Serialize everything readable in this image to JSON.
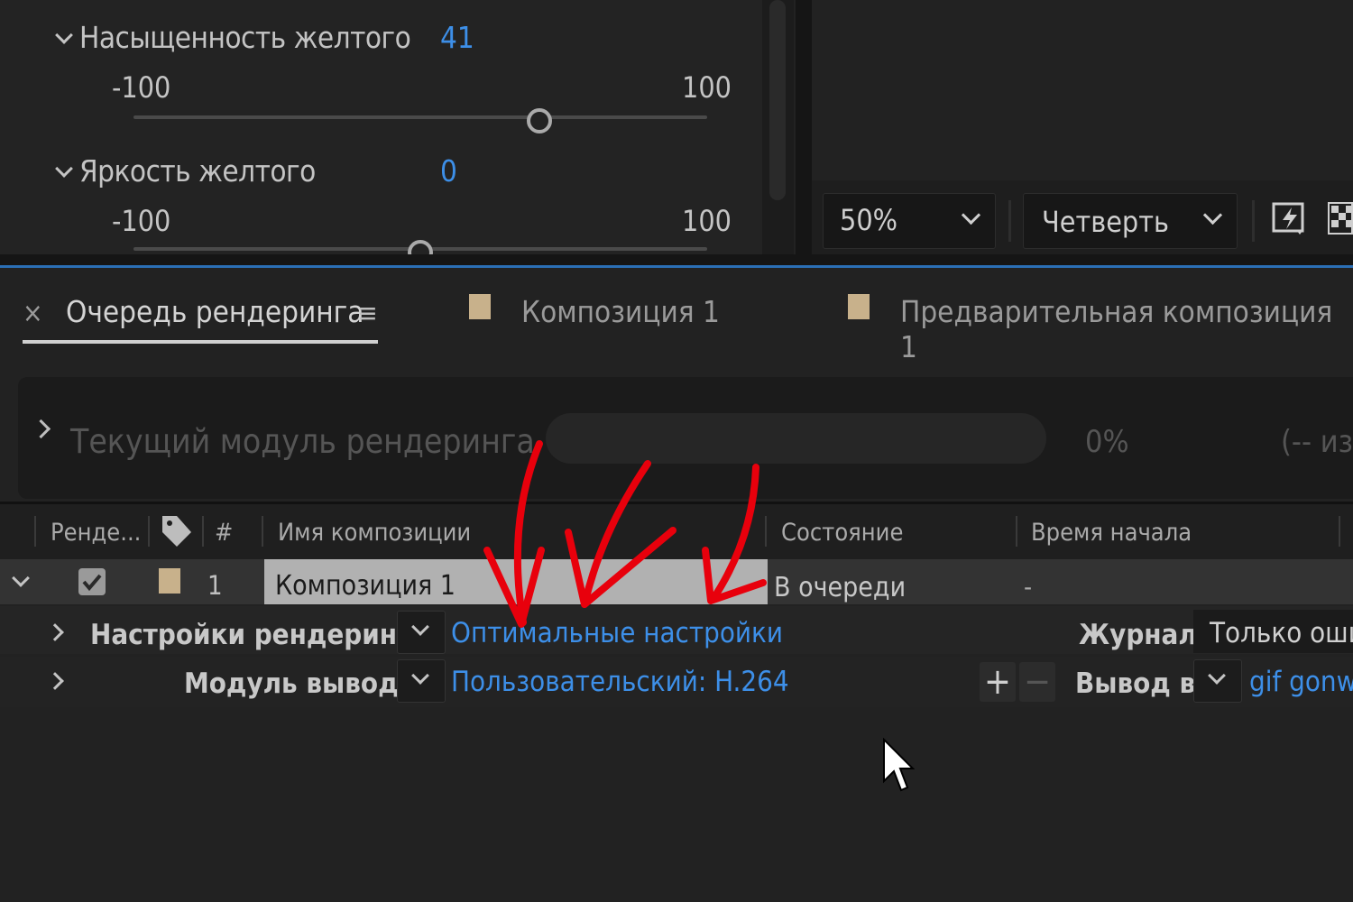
{
  "effects": {
    "props": [
      {
        "label": "Насыщенность желтого",
        "value": "41",
        "min": "-100",
        "max": "100",
        "level": 0.705
      },
      {
        "label": "Яркость желтого",
        "value": "0",
        "min": "-100",
        "max": "100",
        "level": 0.5
      }
    ]
  },
  "viewer": {
    "zoom": "50%",
    "resolution": "Четверть"
  },
  "tabs": [
    {
      "label": "Очередь рендеринга",
      "active": true
    },
    {
      "label": "Композиция 1",
      "active": false
    },
    {
      "label": "Предварительная композиция 1",
      "active": false
    }
  ],
  "current_render": {
    "label": "Текущий модуль рендеринга",
    "percent": "0%",
    "remaining": "(-- из"
  },
  "table": {
    "headers": {
      "render": "Ренде...",
      "num": "#",
      "comp_name": "Имя композиции",
      "status": "Состояние",
      "start_time": "Время начала"
    },
    "rows": [
      {
        "num": "1",
        "comp_name": "Композиция 1",
        "status": "В очереди",
        "start_time": "-",
        "checked": true
      }
    ],
    "render_settings": {
      "label": "Настройки рендеринга:",
      "value": "Оптимальные настройки"
    },
    "output_module": {
      "label": "Модуль вывода:",
      "value": "Пользовательский: H.264"
    },
    "log": {
      "label": "Журнал:",
      "value": "Только оши"
    },
    "output_to": {
      "label": "Вывод в:",
      "value": "gif gonwi"
    }
  },
  "colors": {
    "accent": "#3d8fe8",
    "annotation": "#e8000c",
    "swatch": "#c8b18b"
  }
}
